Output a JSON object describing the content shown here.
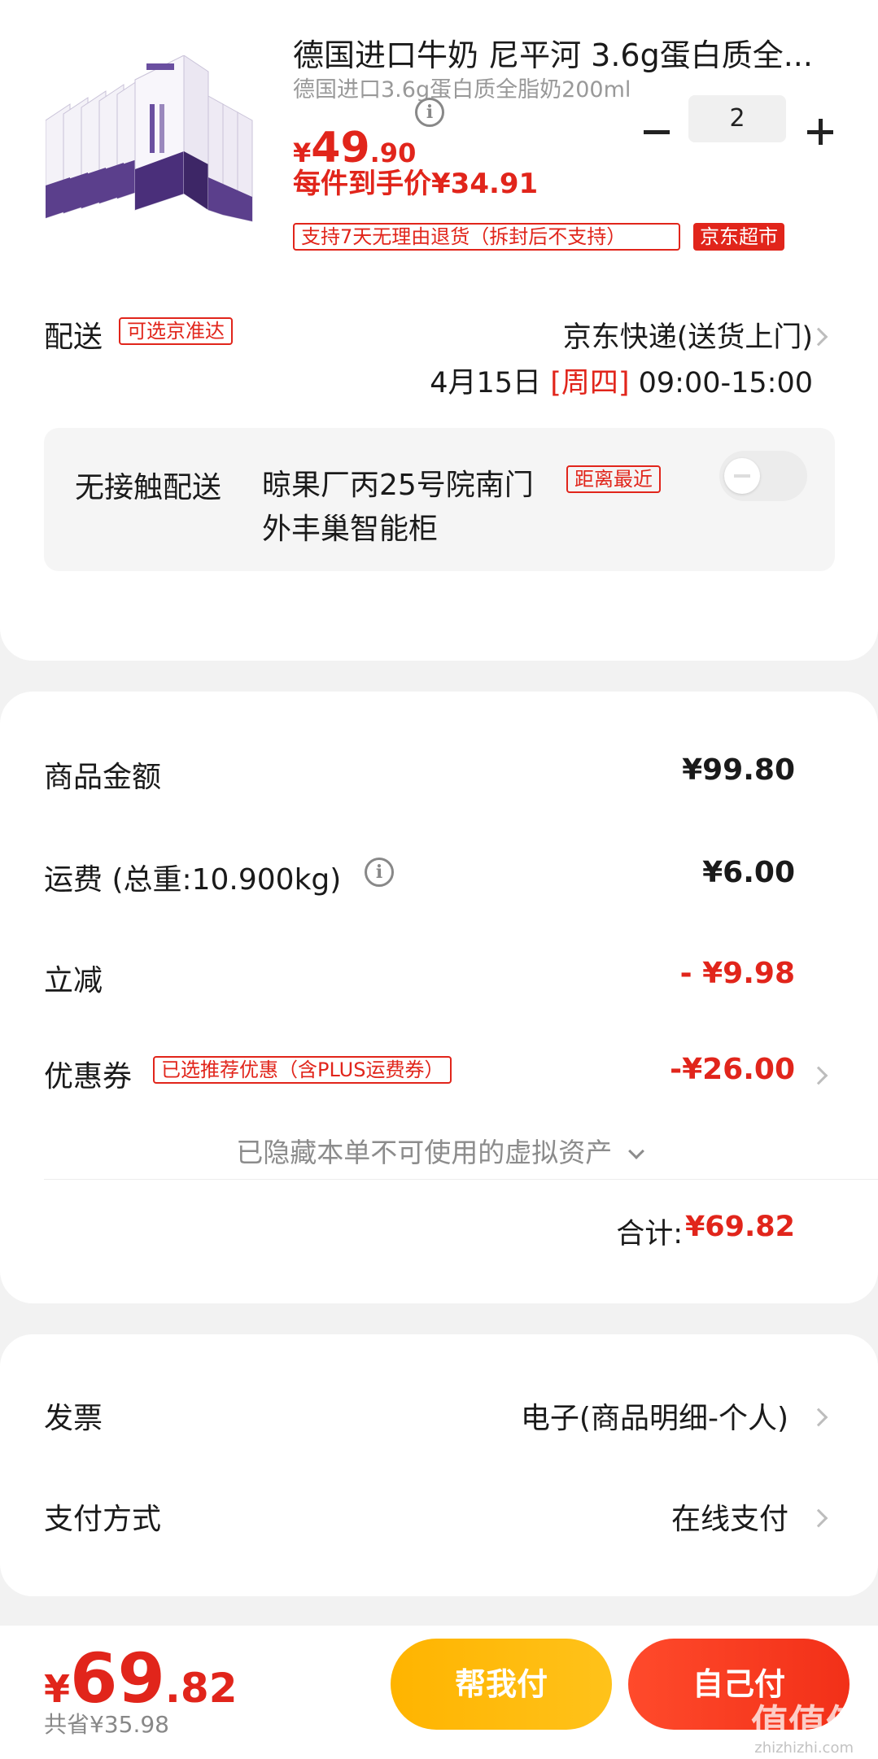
{
  "product": {
    "title": "德国进口牛奶 尼平河 3.6g蛋白质全...",
    "subtitle": "德国进口3.6g蛋白质全脂奶200ml",
    "price_currency": "¥",
    "price_int": "49",
    "price_dec": ".90",
    "info_glyph": "i",
    "quantity": "2",
    "unit_price": "每件到手价¥34.91",
    "return_tag": "支持7天无理由退货（拆封后不支持）",
    "store_tag": "京东超市",
    "image_icon": "milk-carton-pack"
  },
  "delivery": {
    "label": "配送",
    "tag": "可选京准达",
    "method": "京东快递(送货上门)",
    "date": "4月15日",
    "weekday": "[周四]",
    "time": "09:00-15:00",
    "contactless_label": "无接触配送",
    "contactless_address": "晾果厂丙25号院南门外丰巢智能柜",
    "contactless_tag": "距离最近",
    "contactless_enabled": false
  },
  "summary": {
    "goods_label": "商品金额",
    "goods_value": "¥99.80",
    "shipping_label": "运费 (总重:10.900kg)",
    "shipping_value": "¥6.00",
    "discount_label": "立减",
    "discount_value": "- ¥9.98",
    "coupon_label": "优惠券",
    "coupon_tag": "已选推荐优惠（含PLUS运费券）",
    "coupon_value": "-¥26.00",
    "hidden_assets": "已隐藏本单不可使用的虚拟资产",
    "total_label": "合计:",
    "total_value": "¥69.82"
  },
  "invoice": {
    "label": "发票",
    "value": "电子(商品明细-个人)",
    "payment_label": "支付方式",
    "payment_value": "在线支付"
  },
  "bottom": {
    "currency": "¥",
    "price_int": "69",
    "price_dec": ".82",
    "saved": "共省¥35.98",
    "help_pay": "帮我付",
    "self_pay": "自己付",
    "watermark": "值值值",
    "watermark_url": "zhizhizhi.com"
  },
  "colors": {
    "accent_red": "#e1251b",
    "help_button": "#ffb400",
    "self_button": "#f23018",
    "background": "#f2f2f2"
  }
}
